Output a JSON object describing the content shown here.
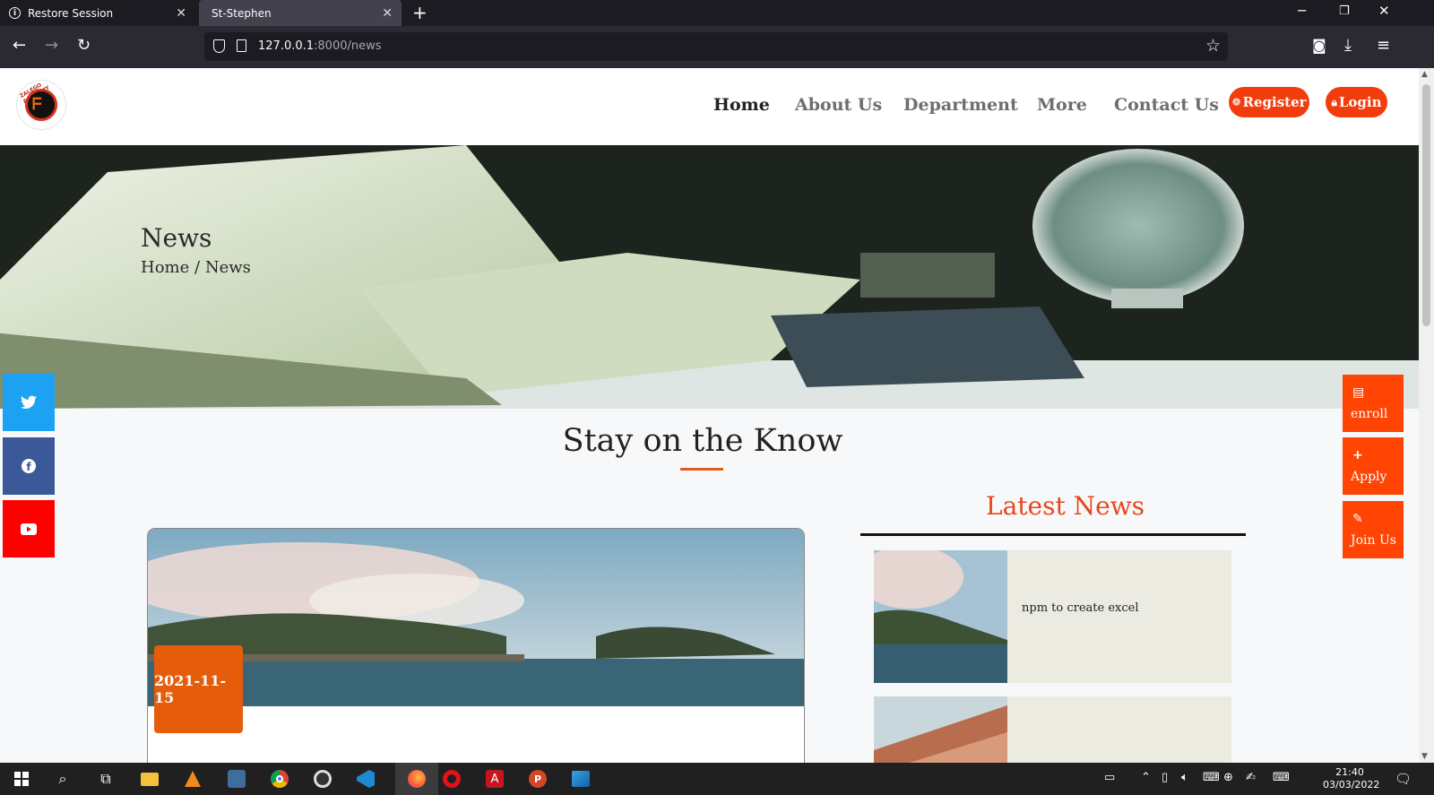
{
  "browser": {
    "tabs": [
      {
        "label": "Restore Session",
        "active": false
      },
      {
        "label": "St-Stephen",
        "active": true
      }
    ],
    "url_host": "127.0.0.1",
    "url_path": ":8000/news"
  },
  "site": {
    "nav": [
      {
        "label": "Home",
        "active": true
      },
      {
        "label": "About Us",
        "active": false
      },
      {
        "label": "Department",
        "active": false
      },
      {
        "label": "More",
        "active": false
      },
      {
        "label": "Contact Us",
        "active": false
      }
    ],
    "register_label": "Register",
    "login_label": "Login",
    "logo_text": "ZALEGO ACADEMY",
    "colors": {
      "accent": "#f23c0c",
      "badge": "#e55c0a",
      "latest_title": "#e8461a",
      "latest_bg": "#ecebe1"
    },
    "hero": {
      "title": "News",
      "breadcrumb_home": "Home",
      "breadcrumb_sep": "/",
      "breadcrumb_current": "News"
    },
    "section_title": "Stay on the Know",
    "news_card": {
      "date": "2021-11-15"
    },
    "latest": {
      "title": "Latest News",
      "items": [
        {
          "title": "npm to create excel"
        },
        {
          "title": ""
        }
      ]
    },
    "social": [
      {
        "name": "twitter",
        "color": "#1da1f2"
      },
      {
        "name": "facebook",
        "color": "#3b5998"
      },
      {
        "name": "youtube",
        "color": "#ff0000"
      }
    ],
    "side_actions": [
      {
        "label": "enroll",
        "icon": "bookmark-icon"
      },
      {
        "label": "Apply",
        "icon": "plus-icon"
      },
      {
        "label": "Join Us",
        "icon": "edit-icon"
      }
    ]
  },
  "taskbar": {
    "time": "21:40",
    "date": "03/03/2022"
  }
}
